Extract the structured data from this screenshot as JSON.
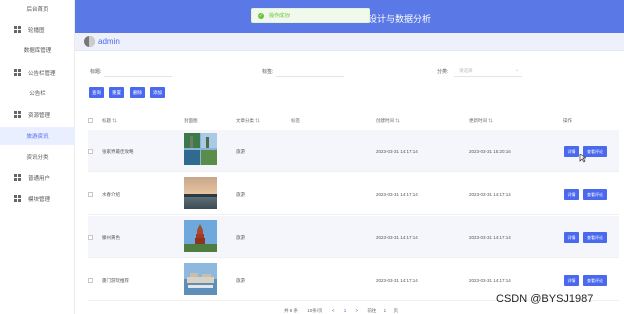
{
  "sidebar": {
    "items": [
      {
        "label": "后台首页",
        "icon": "",
        "type": "sub",
        "active": false
      },
      {
        "label": "轮播图",
        "icon": "grid-icon",
        "type": "group",
        "active": false
      },
      {
        "label": "数据库管理",
        "icon": "",
        "type": "sub",
        "active": false
      },
      {
        "label": "公告栏管理",
        "icon": "grid-icon",
        "type": "group",
        "active": false
      },
      {
        "label": "公告栏",
        "icon": "",
        "type": "sub",
        "active": false
      },
      {
        "label": "资源管理",
        "icon": "grid-icon",
        "type": "group",
        "active": false
      },
      {
        "label": "旅游资讯",
        "icon": "",
        "type": "sub",
        "active": true
      },
      {
        "label": "资讯分类",
        "icon": "",
        "type": "sub",
        "active": false
      },
      {
        "label": "普通用户",
        "icon": "grid-icon",
        "type": "group",
        "active": false
      },
      {
        "label": "模块管理",
        "icon": "grid-icon",
        "type": "group",
        "active": false
      }
    ]
  },
  "header": {
    "title": "设计与数据分析",
    "toast": "操作成功!"
  },
  "user": {
    "name": "admin"
  },
  "filters": {
    "title_label": "标题:",
    "tag_label": "标签:",
    "category_label": "分类:",
    "category_placeholder": "请选择"
  },
  "toolbar": {
    "search": "查询",
    "reset": "重置",
    "delete": "删除",
    "add": "添加"
  },
  "table": {
    "columns": [
      "标题",
      "封面图",
      "文章分类",
      "标签",
      "创建时间",
      "更新时间",
      "操作"
    ],
    "rows": [
      {
        "title": "张家界最佳攻略",
        "category": "旅游",
        "tag": "",
        "created": "2023-03-31 14:17:14",
        "updated": "2023-03-31 15:20:16"
      },
      {
        "title": "水春介绍",
        "category": "旅游",
        "tag": "",
        "created": "2023-03-31 14:17:14",
        "updated": "2023-03-31 14:17:14"
      },
      {
        "title": "滕州黄色",
        "category": "旅游",
        "tag": "",
        "created": "2023-03-31 14:17:14",
        "updated": "2023-03-31 14:17:14"
      },
      {
        "title": "厦门游玩推荐",
        "category": "旅游",
        "tag": "",
        "created": "2023-03-31 14:17:14",
        "updated": "2023-03-31 14:17:14"
      }
    ],
    "detail_label": "详情",
    "comments_label": "查看评论"
  },
  "pagination": {
    "total": "共 8 条",
    "page_size": "10条/页",
    "prev": "<",
    "page": "1",
    "next": ">",
    "goto": "前往",
    "goto_value": "1",
    "page_unit": "页"
  },
  "watermark": "CSDN @BYSJ1987",
  "colors": {
    "primary": "#4a69ee",
    "header": "#5b79e6",
    "toast": "#67c23a"
  }
}
